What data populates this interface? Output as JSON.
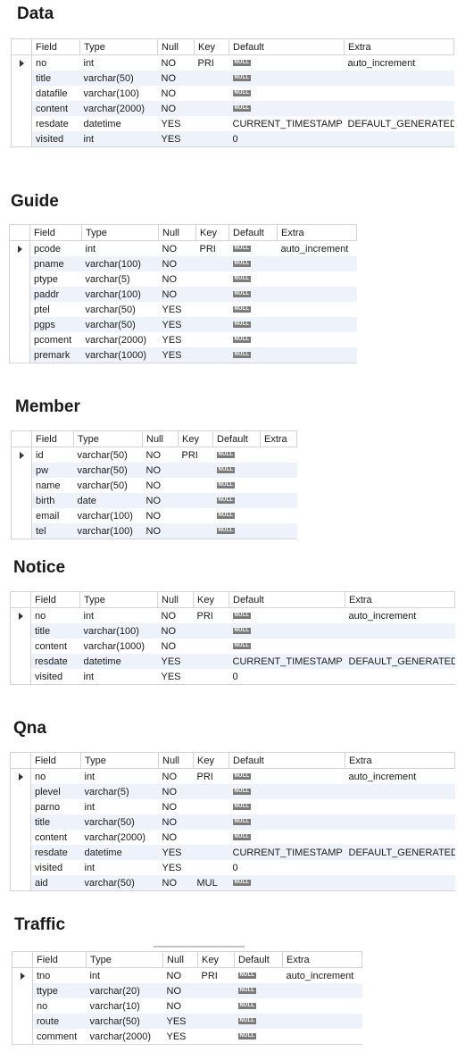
{
  "columns_wide": [
    "Field",
    "Type",
    "Null",
    "Key",
    "Default",
    "Extra"
  ],
  "null_label": "NULL",
  "tables": [
    {
      "title": "Data",
      "rows": [
        [
          "no",
          "int",
          "NO",
          "PRI",
          null,
          "auto_increment"
        ],
        [
          "title",
          "varchar(50)",
          "NO",
          "",
          null,
          ""
        ],
        [
          "datafile",
          "varchar(100)",
          "NO",
          "",
          null,
          ""
        ],
        [
          "content",
          "varchar(2000)",
          "NO",
          "",
          null,
          ""
        ],
        [
          "resdate",
          "datetime",
          "YES",
          "",
          "CURRENT_TIMESTAMP",
          "DEFAULT_GENERATED"
        ],
        [
          "visited",
          "int",
          "YES",
          "",
          "0",
          ""
        ]
      ]
    },
    {
      "title": "Guide",
      "rows": [
        [
          "pcode",
          "int",
          "NO",
          "PRI",
          null,
          "auto_increment"
        ],
        [
          "pname",
          "varchar(100)",
          "NO",
          "",
          null,
          ""
        ],
        [
          "ptype",
          "varchar(5)",
          "NO",
          "",
          null,
          ""
        ],
        [
          "paddr",
          "varchar(100)",
          "NO",
          "",
          null,
          ""
        ],
        [
          "ptel",
          "varchar(50)",
          "YES",
          "",
          null,
          ""
        ],
        [
          "pgps",
          "varchar(50)",
          "YES",
          "",
          null,
          ""
        ],
        [
          "pcoment",
          "varchar(2000)",
          "YES",
          "",
          null,
          ""
        ],
        [
          "premark",
          "varchar(1000)",
          "YES",
          "",
          null,
          ""
        ]
      ]
    },
    {
      "title": "Member",
      "rows": [
        [
          "id",
          "varchar(50)",
          "NO",
          "PRI",
          null,
          ""
        ],
        [
          "pw",
          "varchar(50)",
          "NO",
          "",
          null,
          ""
        ],
        [
          "name",
          "varchar(50)",
          "NO",
          "",
          null,
          ""
        ],
        [
          "birth",
          "date",
          "NO",
          "",
          null,
          ""
        ],
        [
          "email",
          "varchar(100)",
          "NO",
          "",
          null,
          ""
        ],
        [
          "tel",
          "varchar(100)",
          "NO",
          "",
          null,
          ""
        ]
      ]
    },
    {
      "title": "Notice",
      "rows": [
        [
          "no",
          "int",
          "NO",
          "PRI",
          null,
          "auto_increment"
        ],
        [
          "title",
          "varchar(100)",
          "NO",
          "",
          null,
          ""
        ],
        [
          "content",
          "varchar(1000)",
          "NO",
          "",
          null,
          ""
        ],
        [
          "resdate",
          "datetime",
          "YES",
          "",
          "CURRENT_TIMESTAMP",
          "DEFAULT_GENERATED"
        ],
        [
          "visited",
          "int",
          "YES",
          "",
          "0",
          ""
        ]
      ]
    },
    {
      "title": "Qna",
      "rows": [
        [
          "no",
          "int",
          "NO",
          "PRI",
          null,
          "auto_increment"
        ],
        [
          "plevel",
          "varchar(5)",
          "NO",
          "",
          null,
          ""
        ],
        [
          "parno",
          "int",
          "NO",
          "",
          null,
          ""
        ],
        [
          "title",
          "varchar(50)",
          "NO",
          "",
          null,
          ""
        ],
        [
          "content",
          "varchar(2000)",
          "NO",
          "",
          null,
          ""
        ],
        [
          "resdate",
          "datetime",
          "YES",
          "",
          "CURRENT_TIMESTAMP",
          "DEFAULT_GENERATED"
        ],
        [
          "visited",
          "int",
          "YES",
          "",
          "0",
          ""
        ],
        [
          "aid",
          "varchar(50)",
          "NO",
          "MUL",
          null,
          ""
        ]
      ]
    },
    {
      "title": "Traffic",
      "rows": [
        [
          "tno",
          "int",
          "NO",
          "PRI",
          null,
          "auto_increment"
        ],
        [
          "ttype",
          "varchar(20)",
          "NO",
          "",
          null,
          ""
        ],
        [
          "no",
          "varchar(10)",
          "NO",
          "",
          null,
          ""
        ],
        [
          "route",
          "varchar(50)",
          "YES",
          "",
          null,
          ""
        ],
        [
          "comment",
          "varchar(2000)",
          "YES",
          "",
          null,
          ""
        ]
      ]
    }
  ]
}
